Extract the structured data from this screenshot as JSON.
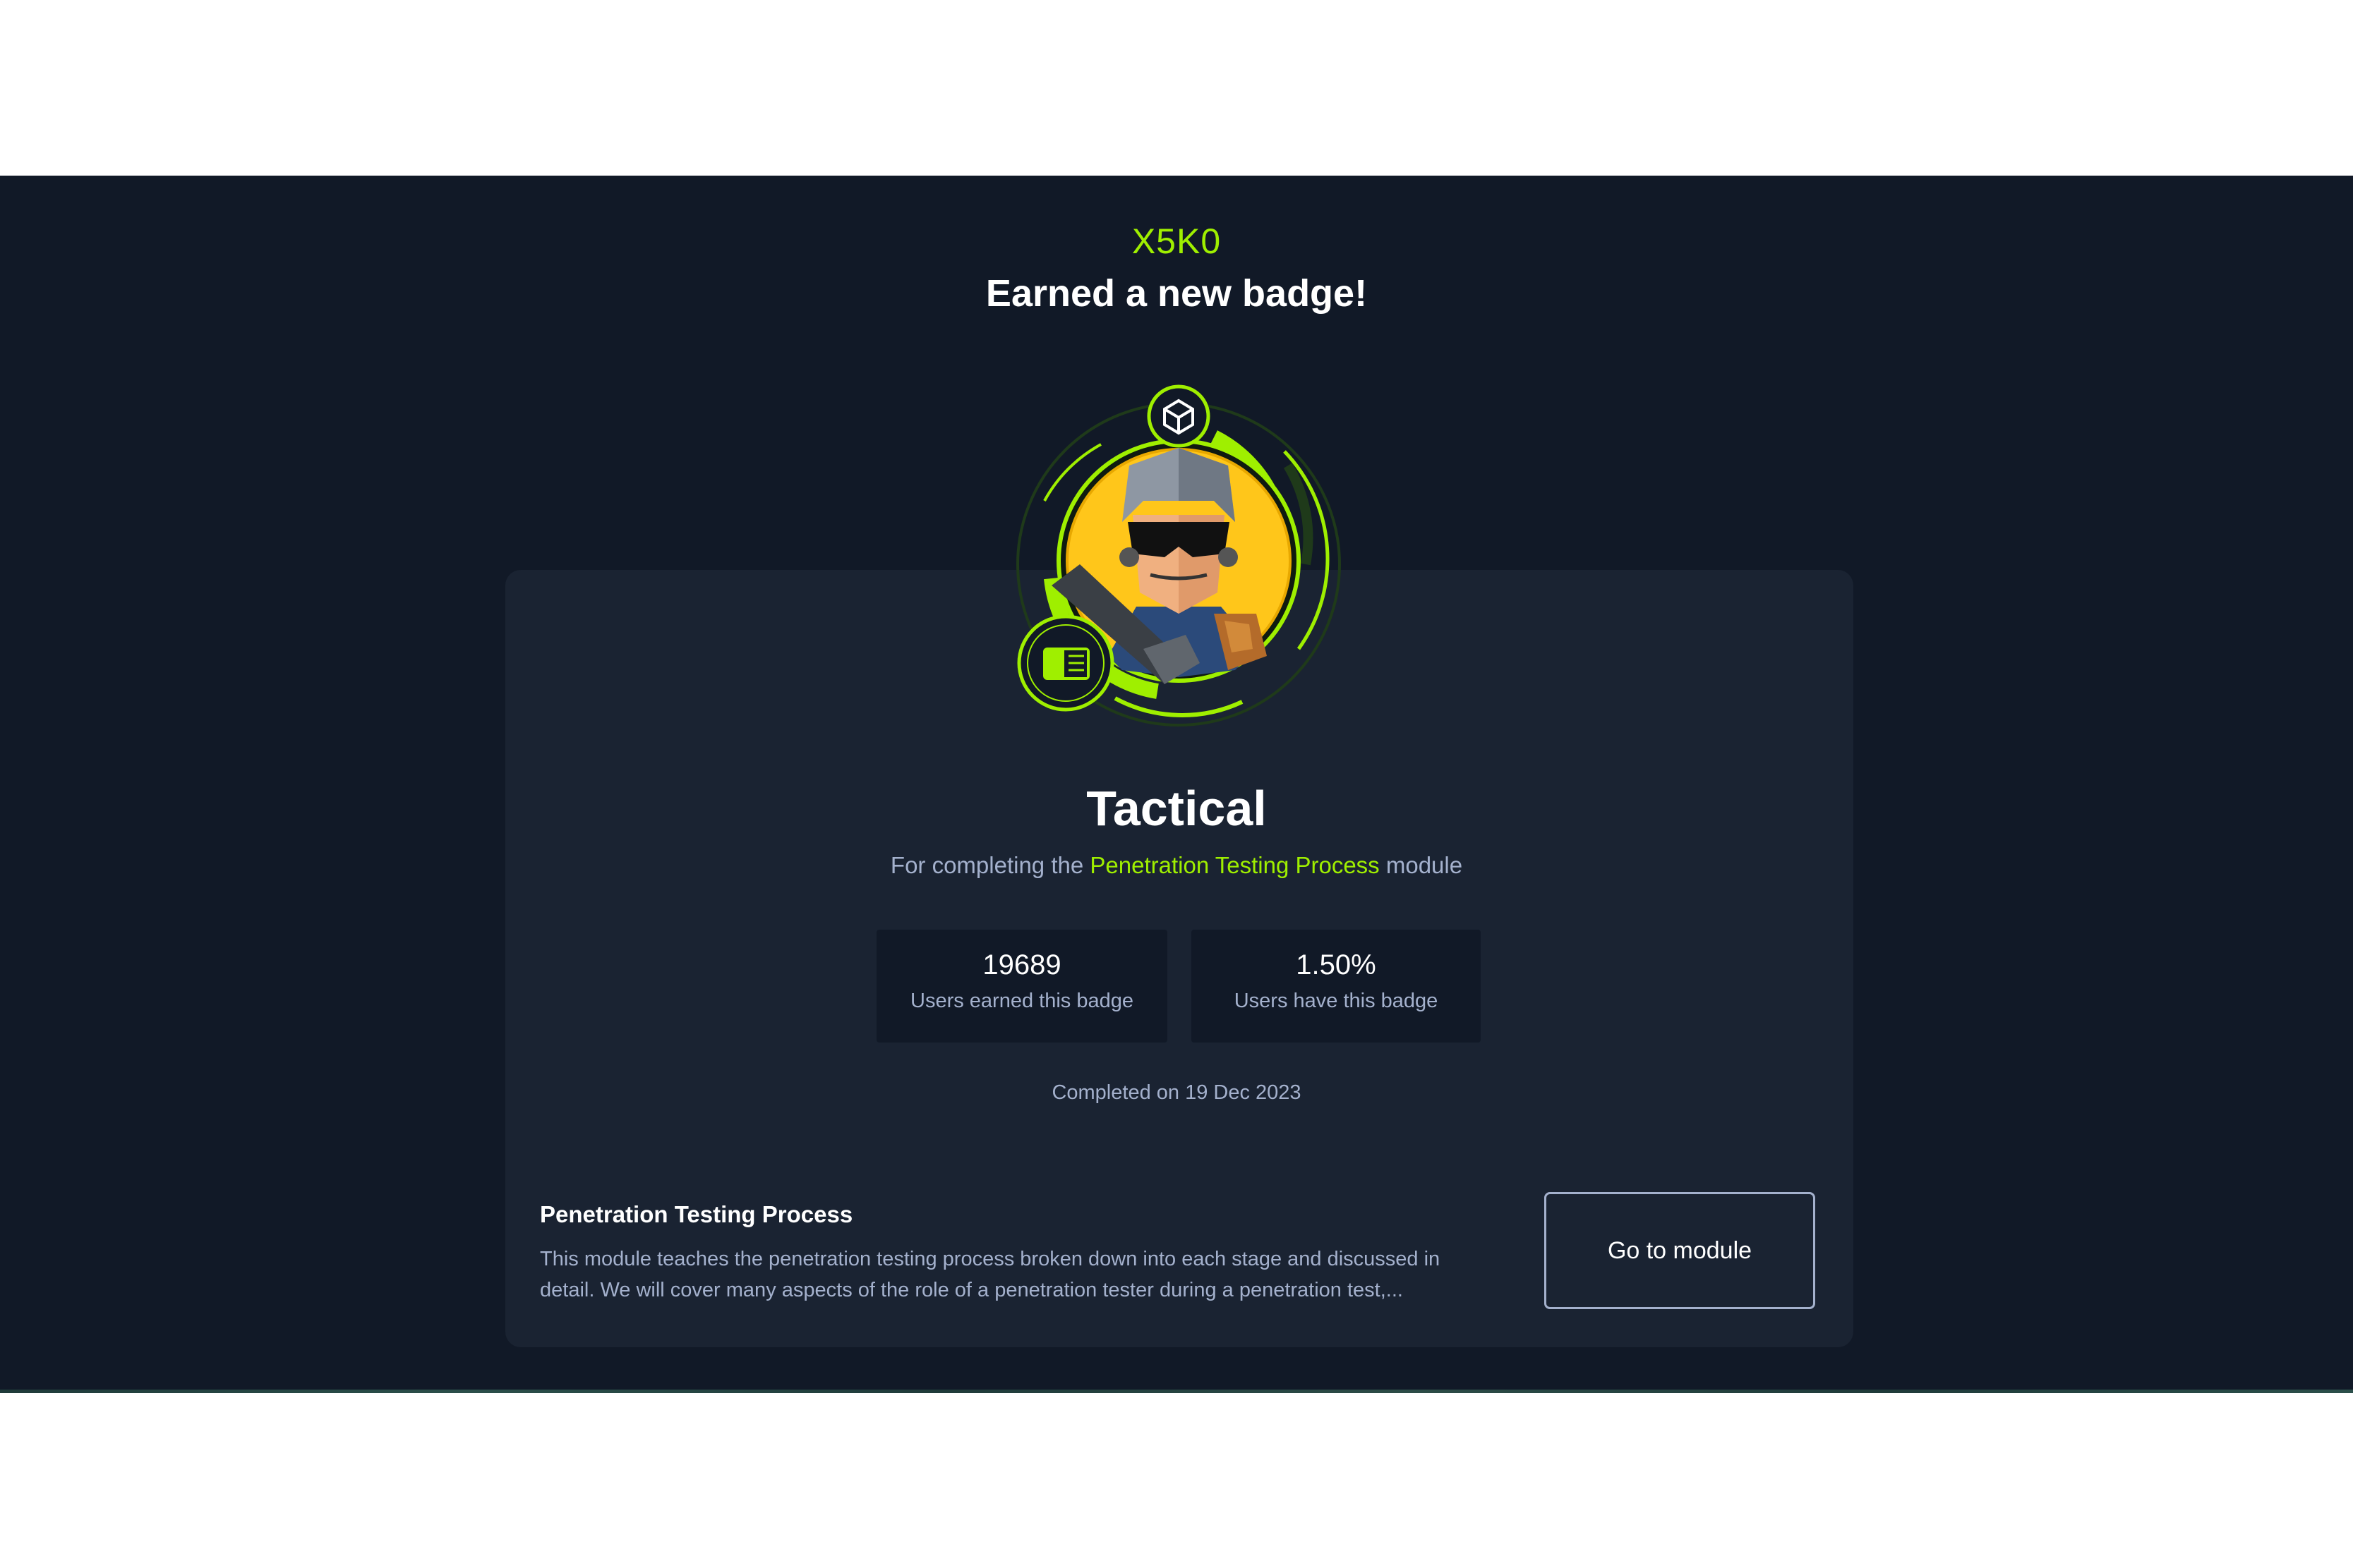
{
  "header": {
    "username": "X5K0",
    "headline": "Earned a new badge!"
  },
  "badge": {
    "icon": "tactical-soldier-badge",
    "name": "Tactical",
    "description_prefix": "For completing the",
    "module_link": "Penetration Testing Process",
    "description_suffix": "module",
    "colors": {
      "accent": "#9fef00",
      "background": "#111927",
      "card": "#1a2332",
      "muted_text": "#a4b1cd"
    }
  },
  "stats": [
    {
      "value": "19689",
      "label": "Users earned this badge"
    },
    {
      "value": "1.50%",
      "label": "Users have this badge"
    }
  ],
  "completed": "Completed on 19 Dec 2023",
  "module": {
    "title": "Penetration Testing Process",
    "description": "This module teaches the penetration testing process broken down into each stage and discussed in detail. We will cover many aspects of the role of a penetration tester during a penetration test,...",
    "button_label": "Go to module"
  }
}
